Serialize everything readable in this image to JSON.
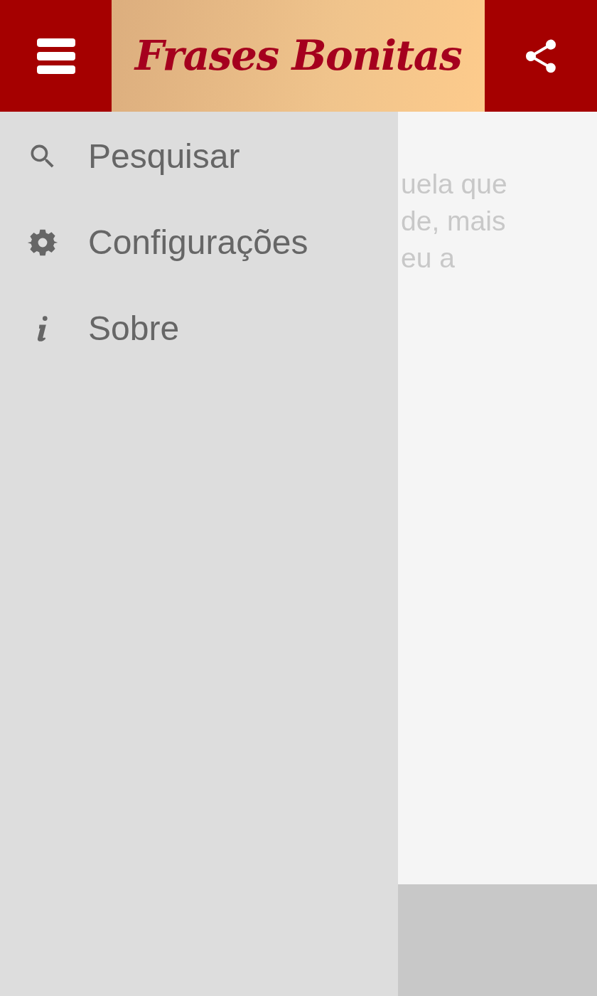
{
  "header": {
    "title": "Frases Bonitas"
  },
  "drawer": {
    "items": [
      {
        "kind": "search",
        "label": "Pesquisar"
      },
      {
        "kind": "settings",
        "label": "Configurações"
      },
      {
        "kind": "about",
        "label": "Sobre"
      }
    ]
  },
  "content": {
    "lines": [
      "uela que",
      "de, mais",
      "eu a"
    ]
  }
}
